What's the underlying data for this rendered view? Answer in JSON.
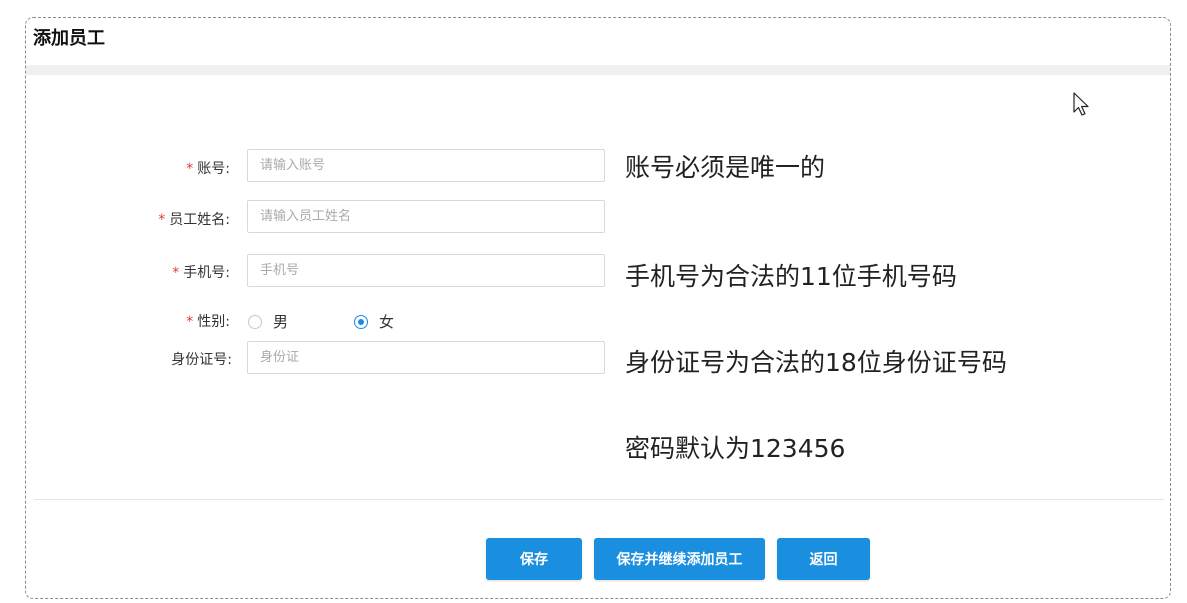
{
  "page": {
    "title": "添加员工"
  },
  "form": {
    "account": {
      "label": "账号:",
      "placeholder": "请输入账号",
      "required": true
    },
    "name": {
      "label": "员工姓名:",
      "placeholder": "请输入员工姓名",
      "required": true
    },
    "phone": {
      "label": "手机号:",
      "placeholder": "手机号",
      "required": true
    },
    "gender": {
      "label": "性别:",
      "required": true,
      "options": [
        "男",
        "女"
      ],
      "selected": "女"
    },
    "idcard": {
      "label": "身份证号:",
      "placeholder": "身份证",
      "required": false
    }
  },
  "notes": {
    "account": "账号必须是唯一的",
    "phone": "手机号为合法的11位手机号码",
    "idcard": "身份证号为合法的18位身份证号码",
    "password": "密码默认为123456"
  },
  "buttons": {
    "save": "保存",
    "save_continue": "保存并继续添加员工",
    "back": "返回"
  },
  "colors": {
    "accent": "#1a8fe0",
    "required": "#e03c3c"
  }
}
